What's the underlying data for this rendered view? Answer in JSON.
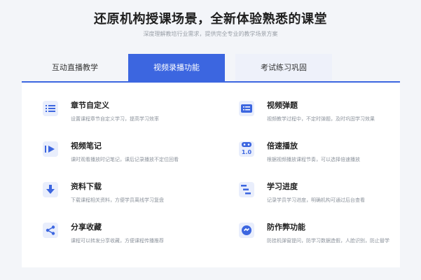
{
  "header": {
    "title": "还原机构授课场景，全新体验熟悉的课堂",
    "subtitle": "深度理解教培行业需求，提供完全专业的教学场景方案"
  },
  "tabs": [
    {
      "label": "互动直播教学",
      "active": false
    },
    {
      "label": "视频录播功能",
      "active": true
    },
    {
      "label": "考试练习巩固",
      "active": false
    }
  ],
  "features": [
    {
      "icon": "list-icon",
      "title": "章节自定义",
      "desc": "设置课程章节自定义学习，提高学习效率"
    },
    {
      "icon": "danmaku-icon",
      "title": "视频弹题",
      "desc": "视频教学过程中，不定时弹题，及时巩固学习效果"
    },
    {
      "icon": "video-note-icon",
      "title": "视频笔记",
      "desc": "课时观看播放时记笔记，课后记录播放不定位回看"
    },
    {
      "icon": "speed-icon",
      "title": "倍速播放",
      "desc": "根据视频播放课程节奏，可以选择倍速播放",
      "badge": "1.0"
    },
    {
      "icon": "download-icon",
      "title": "资料下载",
      "desc": "下载课程相关资料，方便学员离线学习复盘"
    },
    {
      "icon": "progress-icon",
      "title": "学习进度",
      "desc": "记录学员学习进度，明确机构可通过后台查看"
    },
    {
      "icon": "share-icon",
      "title": "分享收藏",
      "desc": "课程可以转发分享收藏，方便课程传播推荐"
    },
    {
      "icon": "anti-cheat-icon",
      "title": "防作弊功能",
      "desc": "防挂机弹窗提问，防学习数据造假，人脸识别，防止替学"
    }
  ],
  "colors": {
    "accent": "#3c66e0",
    "icon_bg": "#e9eefc",
    "background": "#f3f5f9"
  }
}
